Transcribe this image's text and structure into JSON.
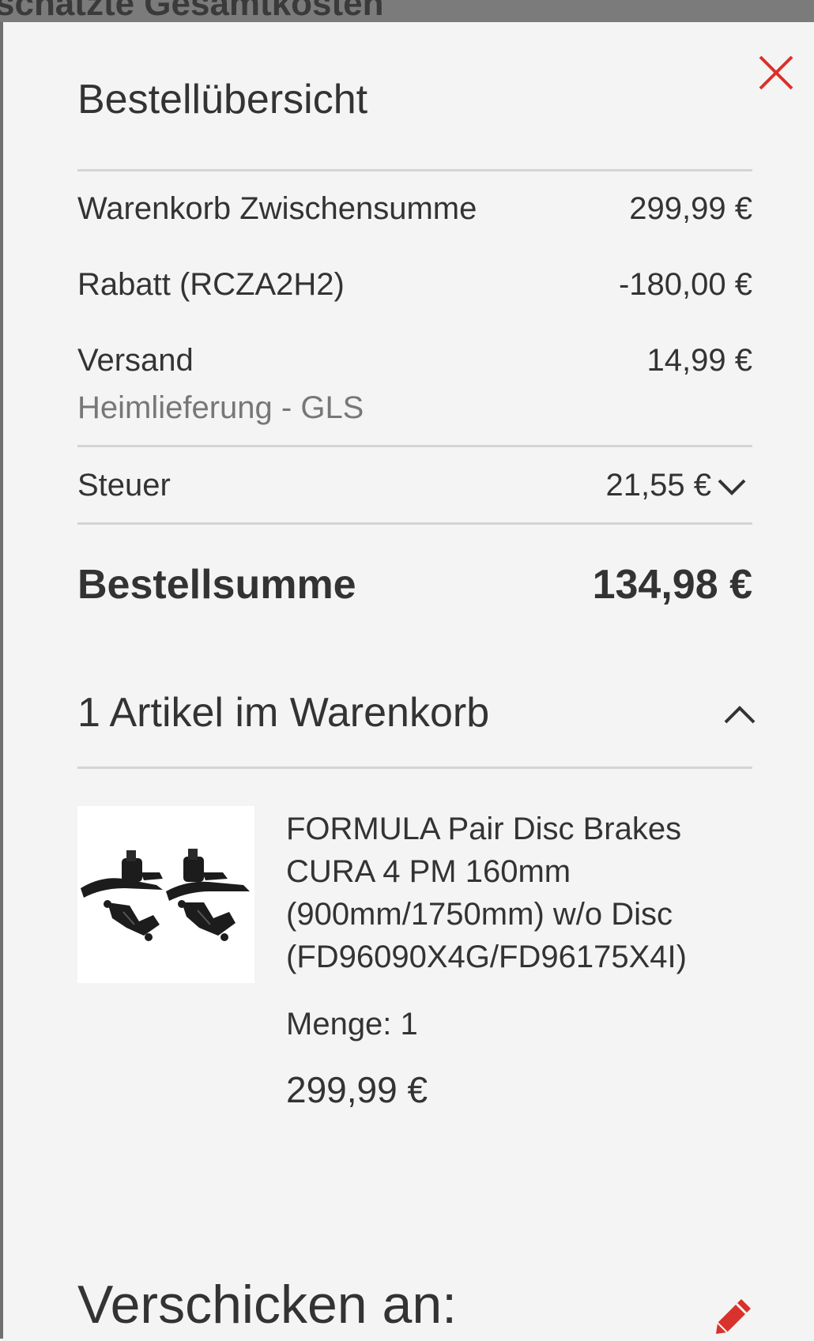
{
  "background": {
    "title": "schätzte Gesamtkosten"
  },
  "colors": {
    "accent": "#d9312b",
    "text": "#333333",
    "muted": "#777777",
    "rule": "#d4d4d4",
    "panel": "#f4f4f4"
  },
  "summary": {
    "title": "Bestellübersicht",
    "close_icon": "close-icon",
    "rows": [
      {
        "label": "Warenkorb Zwischensumme",
        "value": "299,99 €"
      },
      {
        "label": "Rabatt (RCZA2H2)",
        "value": "-180,00 €"
      },
      {
        "label": "Versand",
        "value": "14,99 €",
        "sublabel": "Heimlieferung - GLS"
      }
    ],
    "tax": {
      "label": "Steuer",
      "value": "21,55 €",
      "icon": "chevron-down-icon"
    },
    "total": {
      "label": "Bestellsumme",
      "value": "134,98 €"
    }
  },
  "cart": {
    "heading": "1 Artikel im Warenkorb",
    "toggle_icon": "chevron-up-icon",
    "items": [
      {
        "name": "FORMULA Pair Disc Brakes CURA 4 PM 160mm (900mm/1750mm) w/o Disc (FD96090X4G/FD96175X4I)",
        "quantity": "Menge: 1",
        "price": "299,99 €",
        "image_icon": "disc-brakes-image"
      }
    ]
  },
  "shipping": {
    "heading": "Verschicken an:",
    "edit_icon": "pencil-icon"
  }
}
